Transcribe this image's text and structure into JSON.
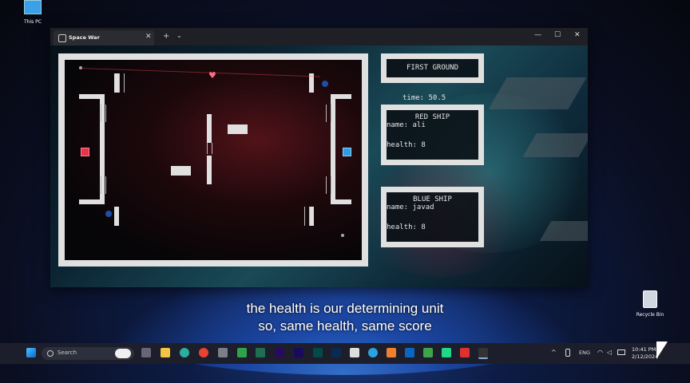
{
  "desktop": {
    "this_pc_label": "This PC",
    "recycle_bin_label": "Recycle Bin"
  },
  "window": {
    "tab_title": "Space War",
    "new_tab": "+",
    "tab_dropdown": "⌄",
    "tab_close": "✕",
    "minimize": "—",
    "maximize": "☐",
    "close": "✕"
  },
  "game": {
    "ground_title": "FIRST GROUND",
    "time_label": "time: 50.5",
    "red_ship": {
      "title": "RED SHIP",
      "name_line": "name: ali",
      "health_line": "health: 8",
      "color": "#e8334a"
    },
    "blue_ship": {
      "title": "BLUE SHIP",
      "name_line": "name: javad",
      "health_line": "health: 8",
      "color": "#2f8ddb"
    },
    "heart_icon": "♥"
  },
  "caption": {
    "line1": "the health is our determining unit",
    "line2": "so, same health, same score"
  },
  "taskbar": {
    "search_placeholder": "Search",
    "language": "ENG",
    "time": "10:41 PM",
    "date": "2/12/2024"
  }
}
